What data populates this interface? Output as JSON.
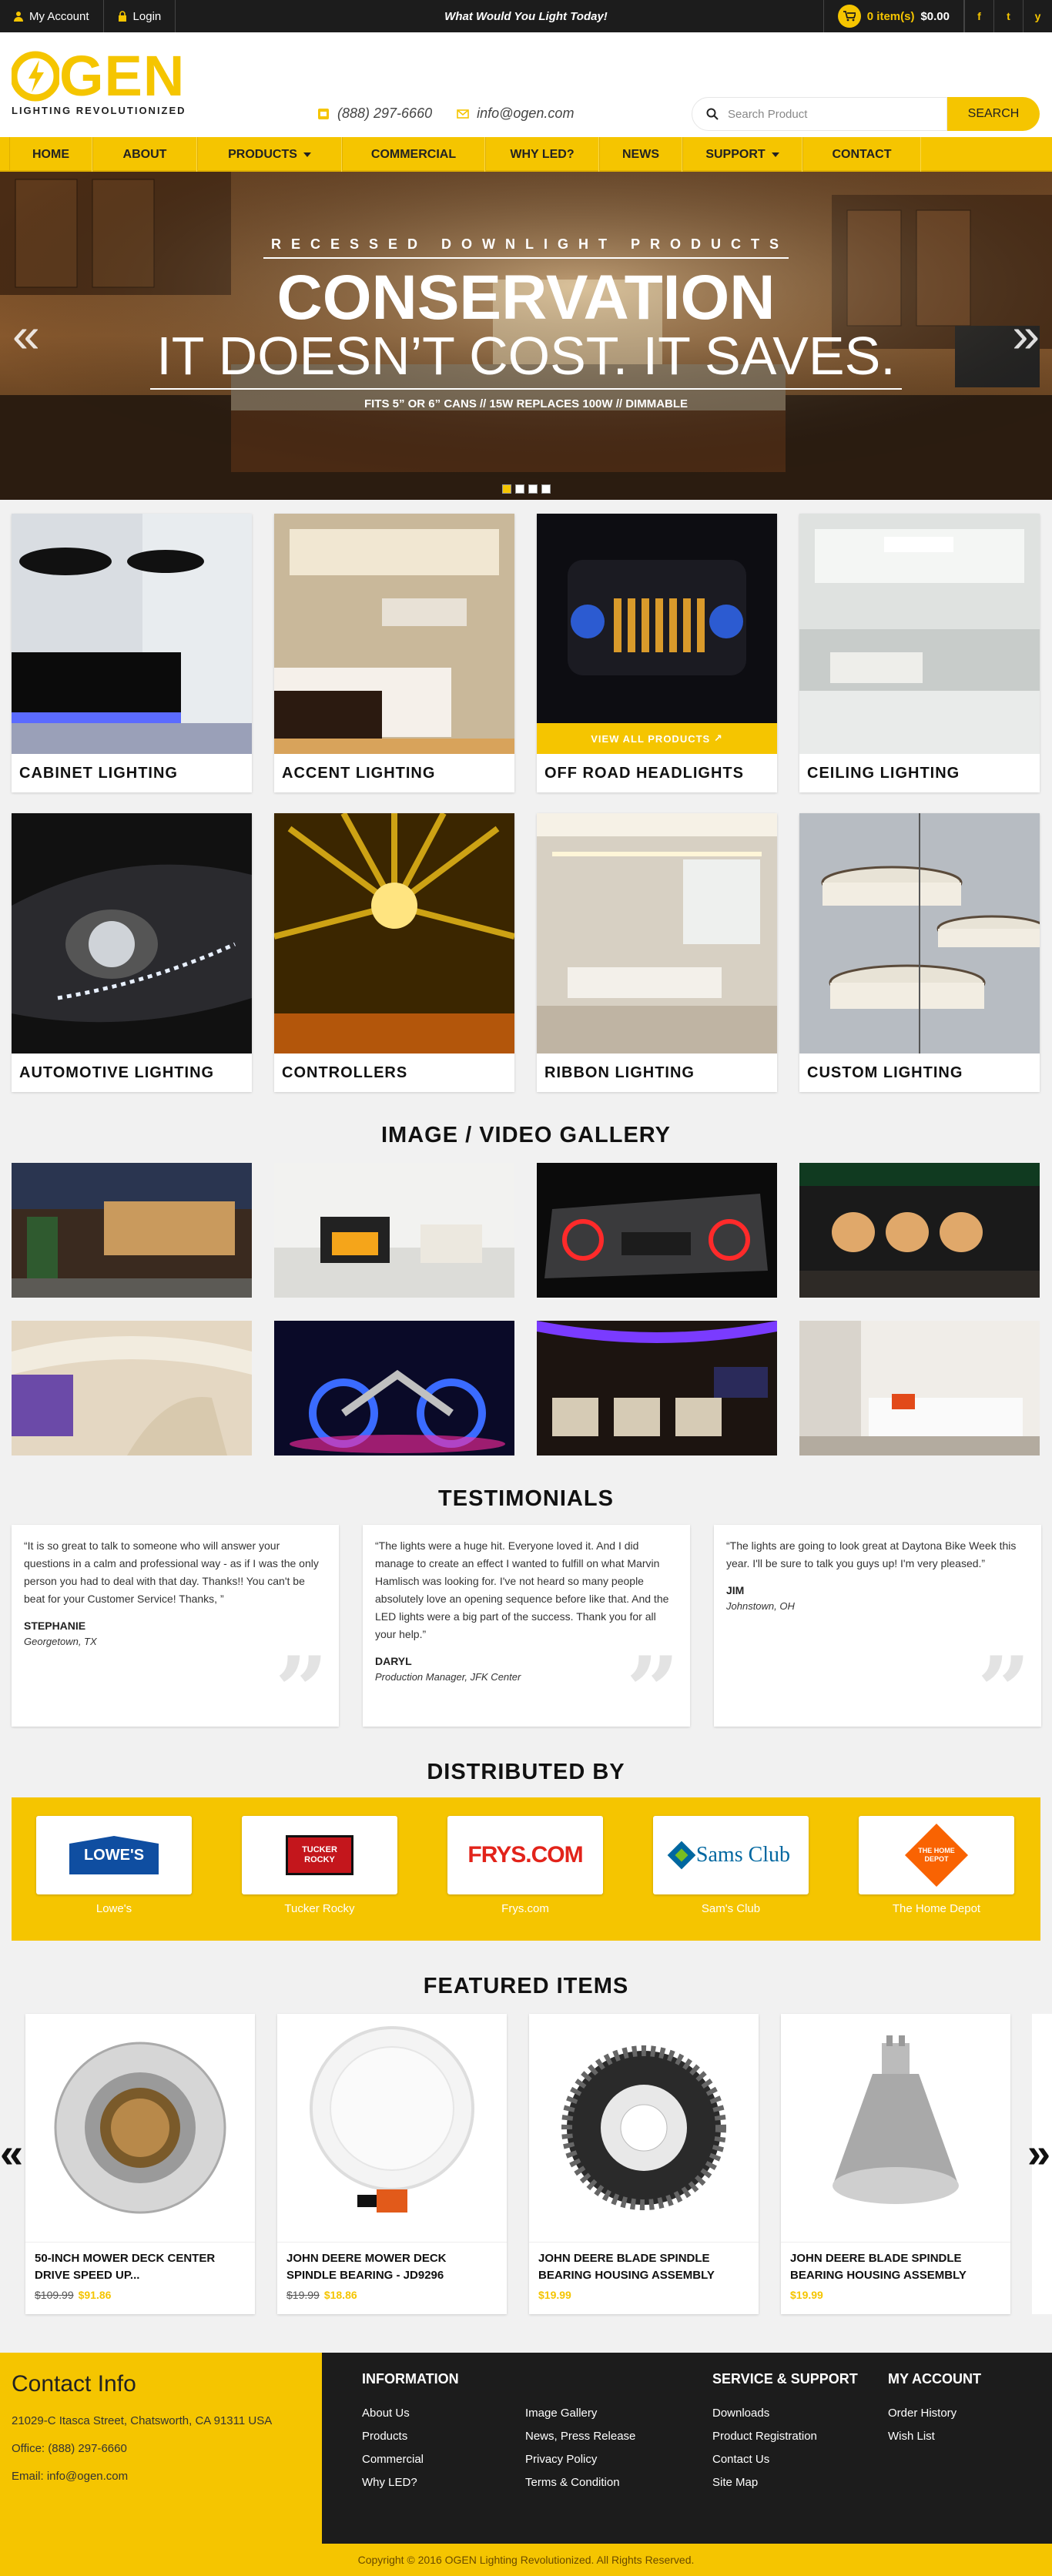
{
  "topbar": {
    "my_account": "My Account",
    "login": "Login",
    "tagline": "What Would You Light Today!",
    "cart_items": "0 item(s)",
    "cart_total": "$0.00",
    "social": [
      "f",
      "t",
      "y"
    ]
  },
  "header": {
    "logo_text": "GEN",
    "logo_tagline": "LIGHTING REVOLUTIONIZED",
    "phone": "(888) 297-6660",
    "email": "info@ogen.com",
    "search_placeholder": "Search Product",
    "search_button": "SEARCH"
  },
  "nav": {
    "items": [
      "HOME",
      "ABOUT",
      "PRODUCTS",
      "COMMERCIAL",
      "WHY LED?",
      "NEWS",
      "SUPPORT",
      "CONTACT"
    ]
  },
  "hero": {
    "subtitle": "RECESSED DOWNLIGHT PRODUCTS",
    "headline": "CONSERVATION",
    "headline2": "IT DOESN’T COST. IT SAVES.",
    "note": "FITS 5” OR 6” CANS // 15W REPLACES 100W // DIMMABLE",
    "prev": "«",
    "next": "»",
    "active_slide": 1,
    "slide_count": 4
  },
  "categories": [
    {
      "label": "CABINET LIGHTING"
    },
    {
      "label": "ACCENT LIGHTING"
    },
    {
      "label": "OFF ROAD HEADLIGHTS",
      "overlay": "VIEW ALL PRODUCTS"
    },
    {
      "label": "CEILING LIGHTING"
    },
    {
      "label": "AUTOMOTIVE LIGHTING"
    },
    {
      "label": "CONTROLLERS"
    },
    {
      "label": "RIBBON LIGHTING"
    },
    {
      "label": "CUSTOM LIGHTING"
    }
  ],
  "gallery": {
    "title": "IMAGE / VIDEO GALLERY"
  },
  "testimonials": {
    "title": "TESTIMONIALS",
    "items": [
      {
        "text": "“It is so great to talk to someone who will answer your questions in a calm and professional way - as if I was the only person you had to deal with that day. Thanks!! You can't be beat for your Customer Service! Thanks, ”",
        "name": "STEPHANIE",
        "location": "Georgetown, TX"
      },
      {
        "text": "“The lights were a huge hit. Everyone loved it. And I did manage to create an effect I wanted to fulfill on what Marvin Hamlisch was looking for. I've not heard so many people absolutely love an opening sequence before like that. And the LED lights were a big part of the success. Thank you for all your help.”",
        "name": "DARYL",
        "location": "Production Manager, JFK Center"
      },
      {
        "text": "“The lights are going to look great at Daytona Bike Week this year. I'll be sure to talk you guys up! I'm very pleased.”",
        "name": "JIM",
        "location": "Johnstown, OH"
      }
    ]
  },
  "distributed": {
    "title": "DISTRIBUTED BY",
    "brands": [
      "Lowe's",
      "Tucker Rocky",
      "Frys.com",
      "Sam's Club",
      "The Home Depot"
    ],
    "logo_text": [
      "LOWE'S",
      "TUCKER ROCKY",
      "FRYS.COM",
      "Sams Club",
      "THE HOME DEPOT"
    ]
  },
  "featured": {
    "title": "FEATURED ITEMS",
    "prev": "«",
    "next": "»",
    "items": [
      {
        "name": "50-INCH MOWER DECK CENTER DRIVE SPEED UP...",
        "old_price": "$109.99",
        "price": "$91.86"
      },
      {
        "name": "JOHN DEERE MOWER DECK SPINDLE BEARING - JD9296",
        "old_price": "$19.99",
        "price": "$18.86"
      },
      {
        "name": "JOHN DEERE BLADE SPINDLE BEARING HOUSING ASSEMBLY",
        "old_price": "",
        "price": "$19.99"
      },
      {
        "name": "JOHN DEERE BLADE SPINDLE BEARING HOUSING ASSEMBLY",
        "old_price": "",
        "price": "$19.99"
      }
    ]
  },
  "footer": {
    "contact_title": "Contact Info",
    "address": "21029-C Itasca Street, Chatsworth, CA 91311 USA",
    "office": "Office: (888) 297-6660",
    "email": "Email: info@ogen.com",
    "information_title": "INFORMATION",
    "information_col1": [
      "About Us",
      "Products",
      "Commercial",
      "Why LED?"
    ],
    "information_col2": [
      "Image Gallery",
      "News, Press Release",
      "Privacy Policy",
      "Terms & Condition"
    ],
    "service_title": "SERVICE & SUPPORT",
    "service_links": [
      "Downloads",
      "Product Registration",
      "Contact Us",
      "Site Map"
    ],
    "account_title": "MY ACCOUNT",
    "account_links": [
      "Order History",
      "Wish List"
    ],
    "copyright": "Copyright © 2016 OGEN Lighting Revolutionized. All Rights Reserved."
  },
  "colors": {
    "accent": "#f5c500",
    "dark": "#1c1c1c"
  }
}
